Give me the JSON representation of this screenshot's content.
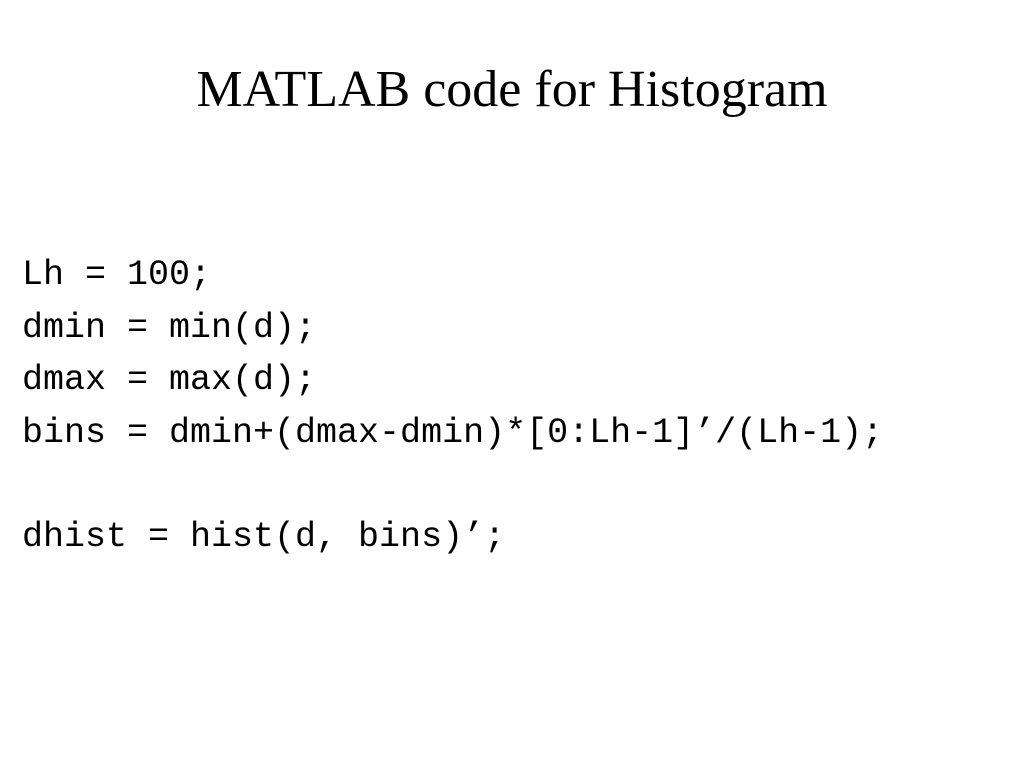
{
  "slide": {
    "title": "MATLAB code for Histogram",
    "code": {
      "line1": "Lh = 100;",
      "line2": "dmin = min(d);",
      "line3": "dmax = max(d);",
      "line4": "bins = dmin+(dmax-dmin)*[0:Lh-1]’/(Lh-1);",
      "line5": "dhist = hist(d, bins)’;"
    }
  }
}
